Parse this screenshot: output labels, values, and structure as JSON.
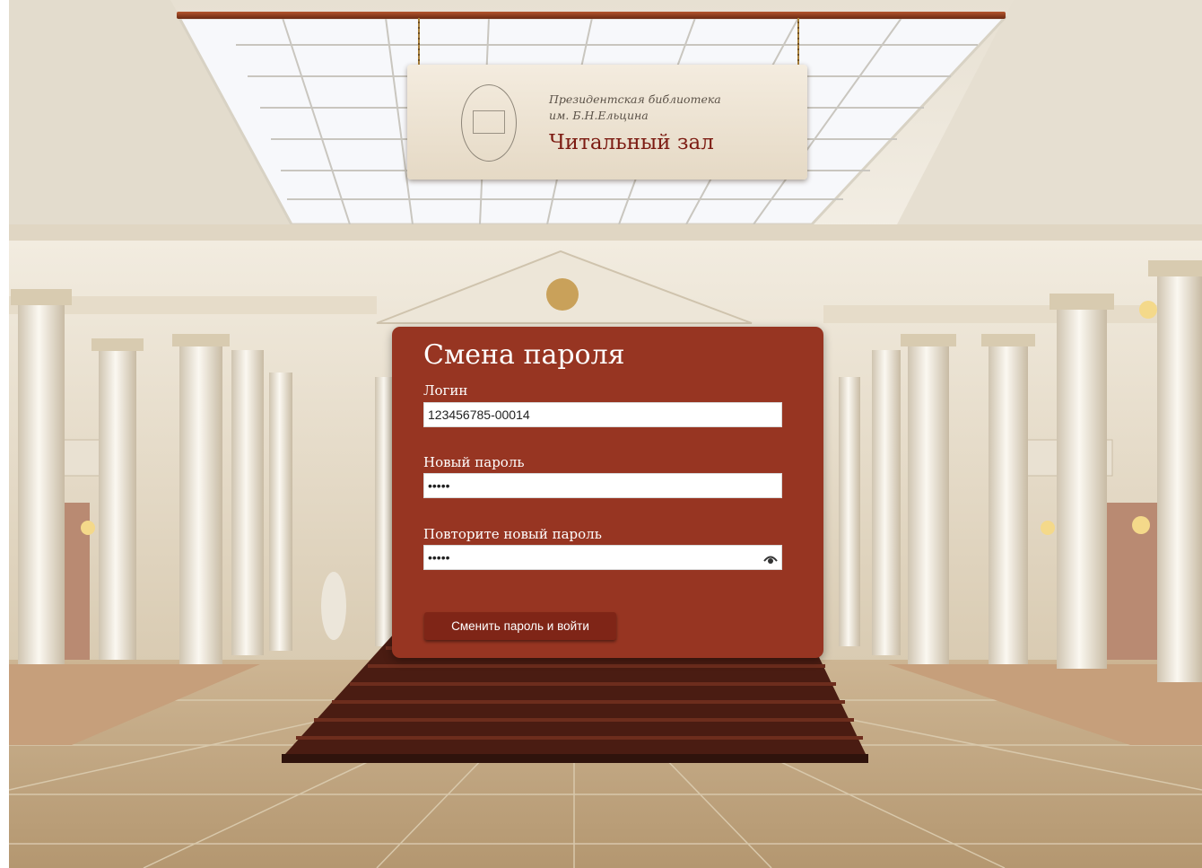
{
  "sign": {
    "subtitle_line1": "Президентская библиотека",
    "subtitle_line2": "им. Б.Н.Ельцина",
    "title": "Читальный зал"
  },
  "form": {
    "title": "Смена пароля",
    "login_label": "Логин",
    "login_value": "123456785-00014",
    "new_password_label": "Новый пароль",
    "new_password_value": "12345",
    "repeat_password_label": "Повторите новый пароль",
    "repeat_password_value": "12345",
    "submit_label": "Сменить пароль и войти",
    "reveal_icon": "eye-icon"
  },
  "colors": {
    "panel": "#973522",
    "button": "#7f2517",
    "sign_title": "#7c1b12"
  }
}
